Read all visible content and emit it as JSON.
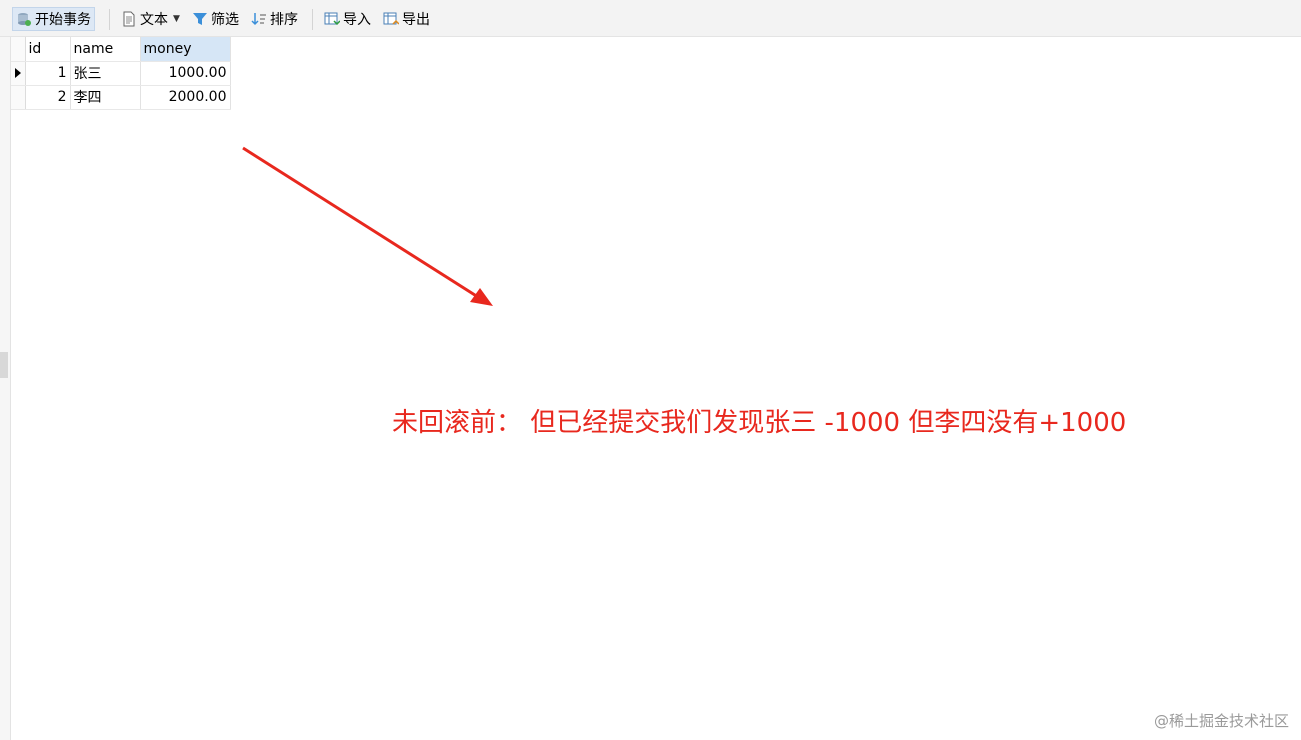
{
  "toolbar": {
    "begin_transaction": "开始事务",
    "text": "文本",
    "filter": "筛选",
    "sort": "排序",
    "import": "导入",
    "export": "导出"
  },
  "table": {
    "columns": [
      "id",
      "name",
      "money"
    ],
    "rows": [
      {
        "id": "1",
        "name": "张三",
        "money": "1000.00"
      },
      {
        "id": "2",
        "name": "李四",
        "money": "2000.00"
      }
    ]
  },
  "annotation": {
    "text": "未回滚前：  但已经提交我们发现张三 -1000 但李四没有+1000",
    "color": "#e8281e"
  },
  "watermark": "@稀土掘金技术社区"
}
